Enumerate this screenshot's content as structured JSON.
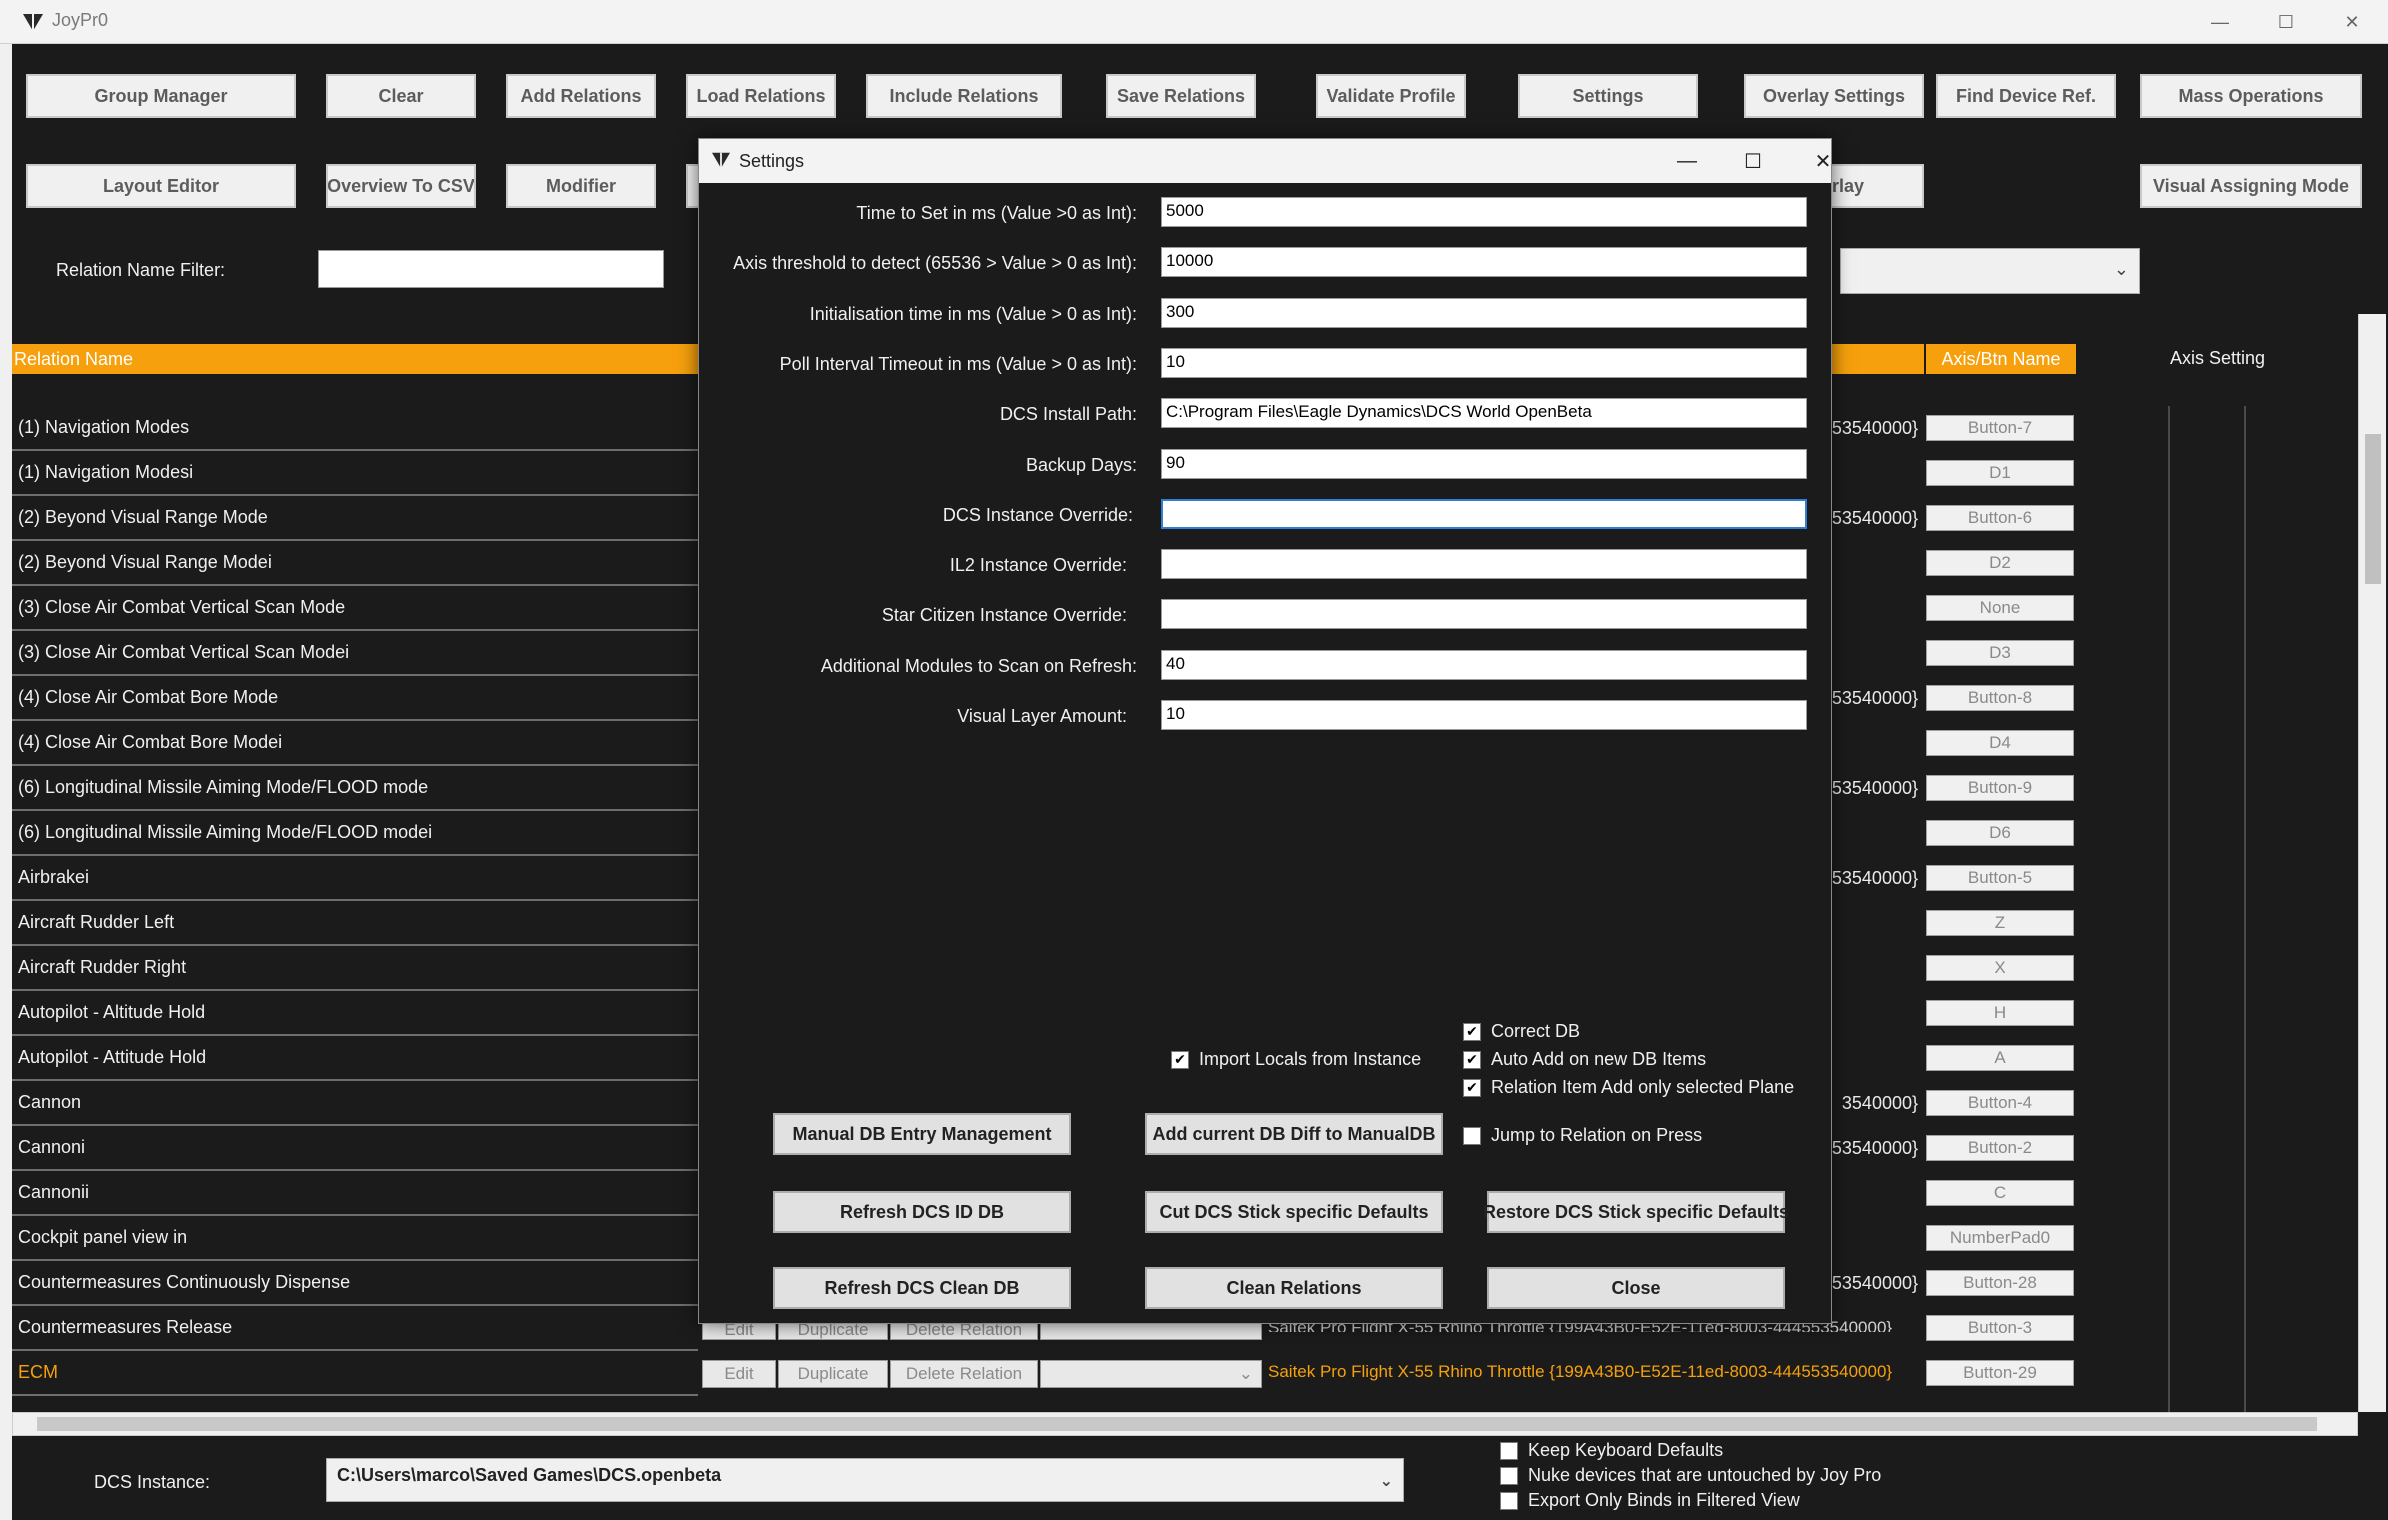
{
  "window": {
    "title": "JoyPr0"
  },
  "toolbar": {
    "row1": [
      "Group Manager",
      "Clear",
      "Add Relations",
      "Load Relations",
      "Include Relations",
      "Save Relations",
      "Validate Profile",
      "Settings",
      "Overlay Settings",
      "Find Device Ref.",
      "Mass Operations"
    ],
    "row2": [
      "Layout Editor",
      "Overview To CSV",
      "Modifier",
      "rlay",
      "Visual Assigning Mode"
    ]
  },
  "filter": {
    "label": "Relation Name Filter:",
    "value": ""
  },
  "table": {
    "headers": {
      "relation_name": "Relation Name",
      "axis_btn_name": "Axis/Btn Name",
      "axis_setting": "Axis Setting"
    },
    "rows": [
      {
        "name": "(1) Navigation Modes",
        "device": "53540000}",
        "btn": "Button-7"
      },
      {
        "name": "(1) Navigation Modesi",
        "device": "",
        "btn": "D1"
      },
      {
        "name": "(2) Beyond Visual Range Mode",
        "device": "53540000}",
        "btn": "Button-6"
      },
      {
        "name": "(2) Beyond Visual Range Modei",
        "device": "",
        "btn": "D2"
      },
      {
        "name": "(3) Close Air Combat Vertical Scan Mode",
        "device": "",
        "btn": "None"
      },
      {
        "name": "(3) Close Air Combat Vertical Scan Modei",
        "device": "",
        "btn": "D3"
      },
      {
        "name": "(4) Close Air Combat Bore Mode",
        "device": "53540000}",
        "btn": "Button-8"
      },
      {
        "name": "(4) Close Air Combat Bore Modei",
        "device": "",
        "btn": "D4"
      },
      {
        "name": "(6) Longitudinal Missile Aiming Mode/FLOOD mode",
        "device": "53540000}",
        "btn": "Button-9"
      },
      {
        "name": "(6) Longitudinal Missile Aiming Mode/FLOOD modei",
        "device": "",
        "btn": "D6"
      },
      {
        "name": "Airbrakei",
        "device": "53540000}",
        "btn": "Button-5"
      },
      {
        "name": "Aircraft Rudder Left",
        "device": "",
        "btn": "Z"
      },
      {
        "name": "Aircraft Rudder Right",
        "device": "",
        "btn": "X"
      },
      {
        "name": "Autopilot - Altitude Hold",
        "device": "",
        "btn": "H"
      },
      {
        "name": "Autopilot - Attitude Hold",
        "device": "",
        "btn": "A"
      },
      {
        "name": "Cannon",
        "device": "3540000}",
        "btn": "Button-4"
      },
      {
        "name": "Cannoni",
        "device": "53540000}",
        "btn": "Button-2"
      },
      {
        "name": "Cannonii",
        "device": "",
        "btn": "C"
      },
      {
        "name": "Cockpit panel view in",
        "device": "",
        "btn": "NumberPad0"
      },
      {
        "name": "Countermeasures Continuously Dispense",
        "device": "53540000}",
        "btn": "Button-28"
      },
      {
        "name": "Countermeasures Release",
        "device": "",
        "btn": "Button-3"
      },
      {
        "name": "ECM",
        "device": "",
        "btn": "Button-29"
      }
    ],
    "row_actions": {
      "edit": "Edit",
      "duplicate": "Duplicate",
      "delete": "Delete Relation"
    },
    "ecm_device": "Saitek Pro Flight X-55 Rhino Throttle {199A43B0-E52E-11ed-8003-444553540000}",
    "above_device": "Saitek Pro Flight X-55 Rhino Throttle {199A43B0-E52E-11ed-8003-444553540000}"
  },
  "bottom": {
    "dcs_label": "DCS Instance:",
    "dcs_value": "C:\\Users\\marco\\Saved Games\\DCS.openbeta",
    "checks": [
      "Keep Keyboard Defaults",
      "Nuke devices that are untouched by Joy Pro",
      "Export Only Binds in Filtered View"
    ]
  },
  "settings": {
    "title": "Settings",
    "fields": [
      {
        "label": "Time to Set in ms (Value >0 as Int):",
        "value": "5000"
      },
      {
        "label": "Axis threshold to detect (65536 > Value > 0 as Int):",
        "value": "10000"
      },
      {
        "label": "Initialisation time in ms (Value > 0 as Int):",
        "value": "300"
      },
      {
        "label": "Poll Interval Timeout in ms (Value > 0 as Int):",
        "value": "10"
      },
      {
        "label": "DCS Install Path:",
        "value": "C:\\Program Files\\Eagle Dynamics\\DCS World OpenBeta"
      },
      {
        "label": "Backup Days:",
        "value": "90"
      },
      {
        "label": "DCS Instance Override:",
        "value": ""
      },
      {
        "label": "IL2 Instance Override:",
        "value": ""
      },
      {
        "label": "Star Citizen Instance Override:",
        "value": ""
      },
      {
        "label": "Additional Modules to Scan on Refresh:",
        "value": "40"
      },
      {
        "label": "Visual Layer Amount:",
        "value": "10"
      }
    ],
    "checks": {
      "import_locals": "Import Locals from Instance",
      "correct_db": "Correct DB",
      "auto_add": "Auto Add on new DB Items",
      "relation_item_add": "Relation Item Add only selected Plane",
      "jump_to_relation": "Jump to Relation on Press"
    },
    "buttons": {
      "manual_db": "Manual DB Entry Management",
      "add_diff": "Add current DB Diff to ManualDB",
      "refresh_id": "Refresh DCS ID DB",
      "cut_defaults": "Cut DCS Stick specific Defaults",
      "restore_defaults": "Restore DCS Stick specific Defaults",
      "refresh_clean": "Refresh DCS Clean DB",
      "clean_relations": "Clean Relations",
      "close": "Close"
    }
  }
}
